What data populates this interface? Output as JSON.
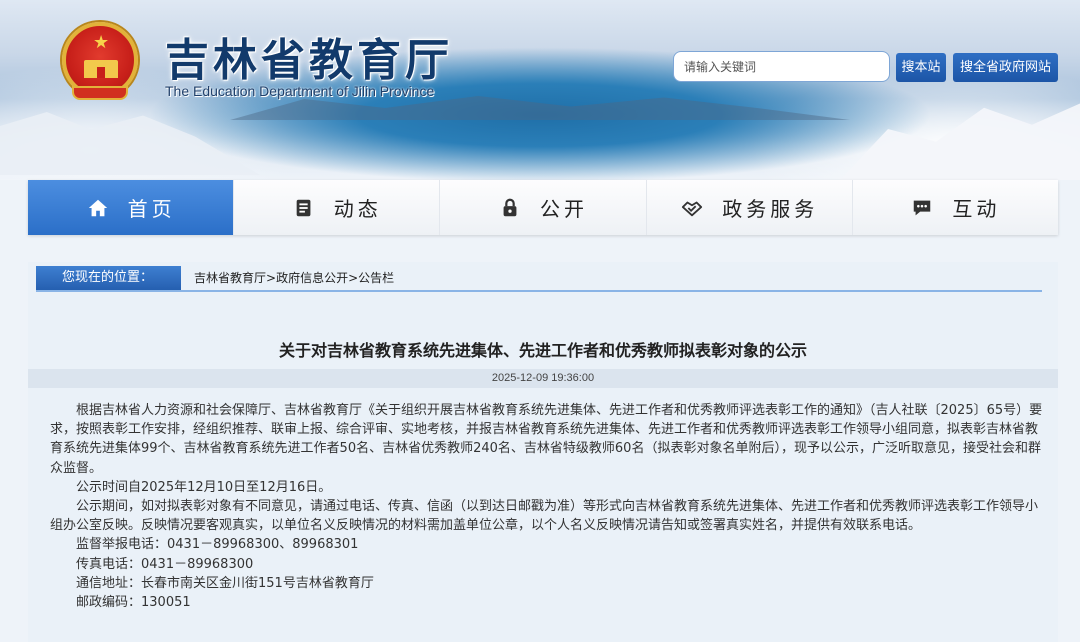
{
  "header": {
    "title": "吉林省教育厅",
    "subtitle": "The Education Department of Jilin Province",
    "search_placeholder": "请输入关键词",
    "search_site_label": "搜本站",
    "search_gov_label": "搜全省政府网站"
  },
  "nav": {
    "items": [
      {
        "label": "首页",
        "icon": "home-icon",
        "active": true
      },
      {
        "label": "动态",
        "icon": "news-icon",
        "active": false
      },
      {
        "label": "公开",
        "icon": "lock-icon",
        "active": false
      },
      {
        "label": "政务服务",
        "icon": "handshake-icon",
        "active": false
      },
      {
        "label": "互动",
        "icon": "chat-icon",
        "active": false
      }
    ]
  },
  "breadcrumb": {
    "label": "您现在的位置：",
    "items": [
      "吉林省教育厅",
      "政府信息公开",
      "公告栏"
    ],
    "separator": ">"
  },
  "article": {
    "title": "关于对吉林省教育系统先进集体、先进工作者和优秀教师拟表彰对象的公示",
    "date": "2025-12-09 19:36:00",
    "paragraphs": [
      "根据吉林省人力资源和社会保障厅、吉林省教育厅《关于组织开展吉林省教育系统先进集体、先进工作者和优秀教师评选表彰工作的通知》（吉人社联〔2025〕65号）要求，按照表彰工作安排，经组织推荐、联审上报、综合评审、实地考核，并报吉林省教育系统先进集体、先进工作者和优秀教师评选表彰工作领导小组同意，拟表彰吉林省教育系统先进集体99个、吉林省教育系统先进工作者50名、吉林省优秀教师240名、吉林省特级教师60名（拟表彰对象名单附后），现予以公示，广泛听取意见，接受社会和群众监督。",
      "公示时间自2025年12月10日至12月16日。",
      "公示期间，如对拟表彰对象有不同意见，请通过电话、传真、信函（以到达日邮戳为准）等形式向吉林省教育系统先进集体、先进工作者和优秀教师评选表彰工作领导小组办公室反映。反映情况要客观真实，以单位名义反映情况的材料需加盖单位公章，以个人名义反映情况请告知或签署真实姓名，并提供有效联系电话。"
    ],
    "contacts": [
      "监督举报电话：0431－89968300、89968301",
      "传真电话：0431－89968300",
      "通信地址：长春市南关区金川街151号吉林省教育厅",
      "邮政编码：130051"
    ]
  }
}
